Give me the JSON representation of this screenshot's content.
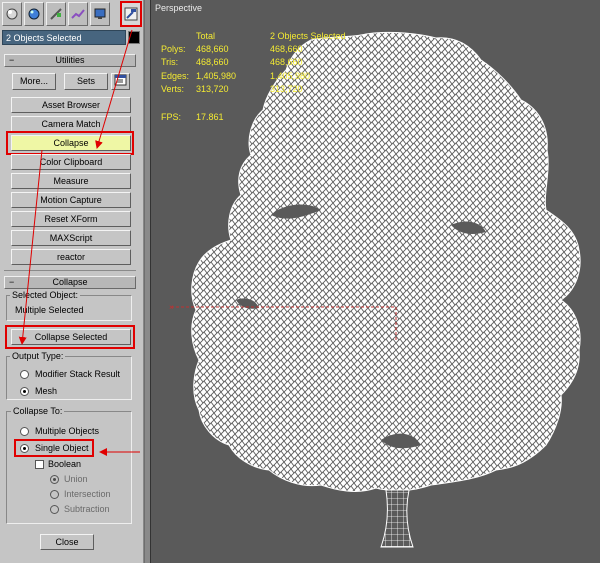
{
  "toolbar": {
    "icons": [
      "create-icon",
      "modify-icon",
      "hierarchy-icon",
      "motion-icon",
      "display-icon",
      "utilities-hammer-icon"
    ]
  },
  "selection": {
    "field_text": "2 Objects Selected",
    "color": "#000000"
  },
  "utilities": {
    "header": "Utilities",
    "more_label": "More...",
    "sets_label": "Sets",
    "buttons": [
      "Asset Browser",
      "Camera Match",
      "Collapse",
      "Color Clipboard",
      "Measure",
      "Motion Capture",
      "Reset XForm",
      "MAXScript",
      "reactor"
    ]
  },
  "collapse": {
    "header": "Collapse",
    "selected_object_title": "Selected Object:",
    "selected_object_value": "Multiple Selected",
    "collapse_selected_label": "Collapse Selected",
    "output_type_title": "Output Type:",
    "output_options": [
      "Modifier Stack Result",
      "Mesh"
    ],
    "output_selected": "Mesh",
    "collapse_to_title": "Collapse To:",
    "collapse_to_options": [
      "Multiple Objects",
      "Single Object"
    ],
    "collapse_to_selected": "Single Object",
    "boolean_label": "Boolean",
    "boolean_checked": false,
    "boolean_options": [
      "Union",
      "Intersection",
      "Subtraction"
    ],
    "boolean_selected": "Union",
    "close_label": "Close"
  },
  "viewport": {
    "label": "Perspective",
    "stats_headers": [
      "Total",
      "2 Objects Selected"
    ],
    "stats_rows": [
      {
        "label": "Polys:",
        "total": "468,660",
        "selected": "468,660"
      },
      {
        "label": "Tris:",
        "total": "468,660",
        "selected": "468,660"
      },
      {
        "label": "Edges:",
        "total": "1,405,980",
        "selected": "1,405,980"
      },
      {
        "label": "Verts:",
        "total": "313,720",
        "selected": "313,720"
      }
    ],
    "fps_label": "FPS:",
    "fps_value": "17.861"
  },
  "colors": {
    "highlight": "#e00000",
    "stats_text": "#f4eb32",
    "wireframe": "#ffffff",
    "viewport_bg": "#5a5a5a"
  }
}
